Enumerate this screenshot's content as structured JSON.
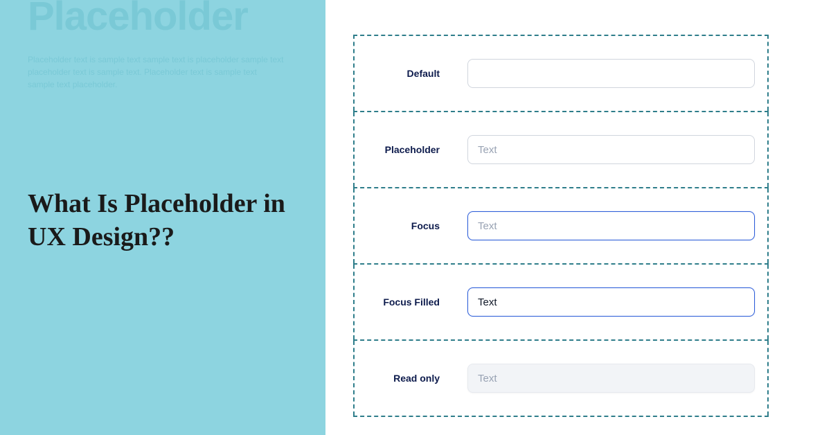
{
  "left": {
    "ghost_heading": "Placeholder",
    "ghost_text": "Placeholder text is sample text sample text is placeholder sample text placeholder text is sample text. Placeholder text is sample text sample text placeholder.",
    "main_heading": "What Is Placeholder in UX Design??"
  },
  "states": [
    {
      "label": "Default",
      "placeholder": "",
      "value": "",
      "variant": "default"
    },
    {
      "label": "Placeholder",
      "placeholder": "Text",
      "value": "",
      "variant": "default"
    },
    {
      "label": "Focus",
      "placeholder": "Text",
      "value": "",
      "variant": "focus"
    },
    {
      "label": "Focus Filled",
      "placeholder": "",
      "value": "Text",
      "variant": "focus"
    },
    {
      "label": "Read only",
      "placeholder": "Text",
      "value": "",
      "variant": "readonly"
    }
  ]
}
